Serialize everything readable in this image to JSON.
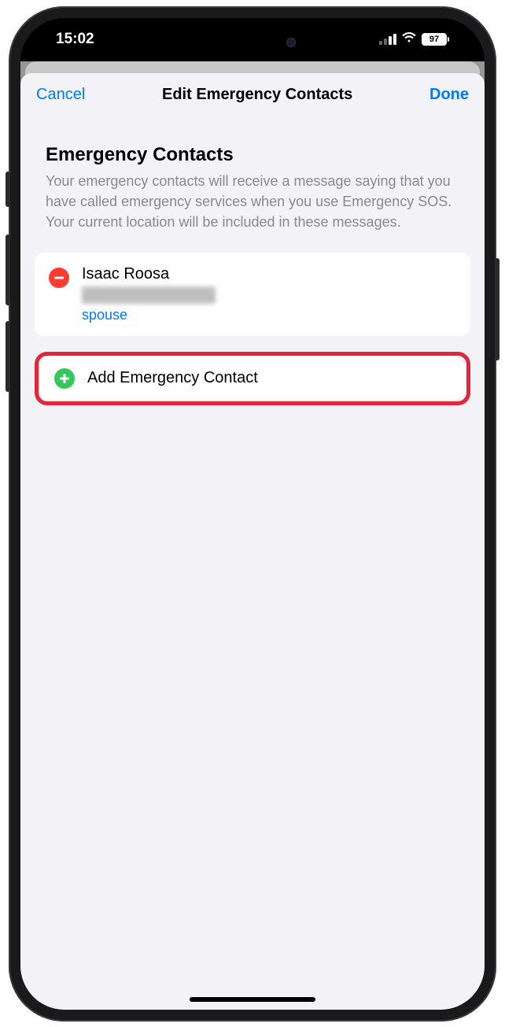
{
  "status": {
    "time": "15:02",
    "battery_pct": "97"
  },
  "nav": {
    "cancel": "Cancel",
    "title": "Edit Emergency Contacts",
    "done": "Done"
  },
  "section": {
    "title": "Emergency Contacts",
    "description": "Your emergency contacts will receive a message saying that you have called emergency services when you use Emergency SOS. Your current location will be included in these messages."
  },
  "contact": {
    "name": "Isaac Roosa",
    "relation": "spouse"
  },
  "add": {
    "label": "Add Emergency Contact"
  }
}
